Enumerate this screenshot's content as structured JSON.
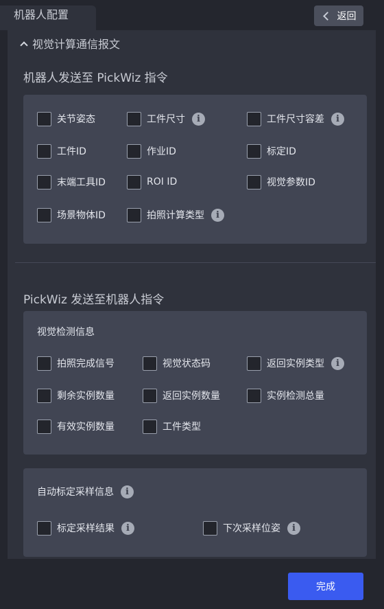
{
  "header": {
    "title": "机器人配置",
    "back_label": "返回"
  },
  "section": {
    "title": "视觉计算通信报文"
  },
  "robot_to_pickwiz": {
    "heading": "机器人发送至 PickWiz 指令",
    "options": [
      "关节姿态",
      "工件尺寸",
      "工件尺寸容差",
      "工件ID",
      "作业ID",
      "标定ID",
      "末端工具ID",
      "ROI ID",
      "视觉参数ID",
      "场景物体ID",
      "拍照计算类型"
    ]
  },
  "pickwiz_to_robot": {
    "heading": "PickWiz 发送至机器人指令",
    "vision_group": {
      "title": "视觉检测信息",
      "options": [
        "拍照完成信号",
        "视觉状态码",
        "返回实例类型",
        "剩余实例数量",
        "返回实例数量",
        "实例检测总量",
        "有效实例数量",
        "工件类型"
      ]
    },
    "calib_group": {
      "title": "自动标定采样信息",
      "options": [
        "标定采样结果",
        "下次采样位姿"
      ]
    }
  },
  "info_glyph": "i",
  "footer": {
    "done_label": "完成"
  },
  "colors": {
    "accent": "#3a5bf0",
    "panel": "#2f323c",
    "card": "#414553"
  }
}
